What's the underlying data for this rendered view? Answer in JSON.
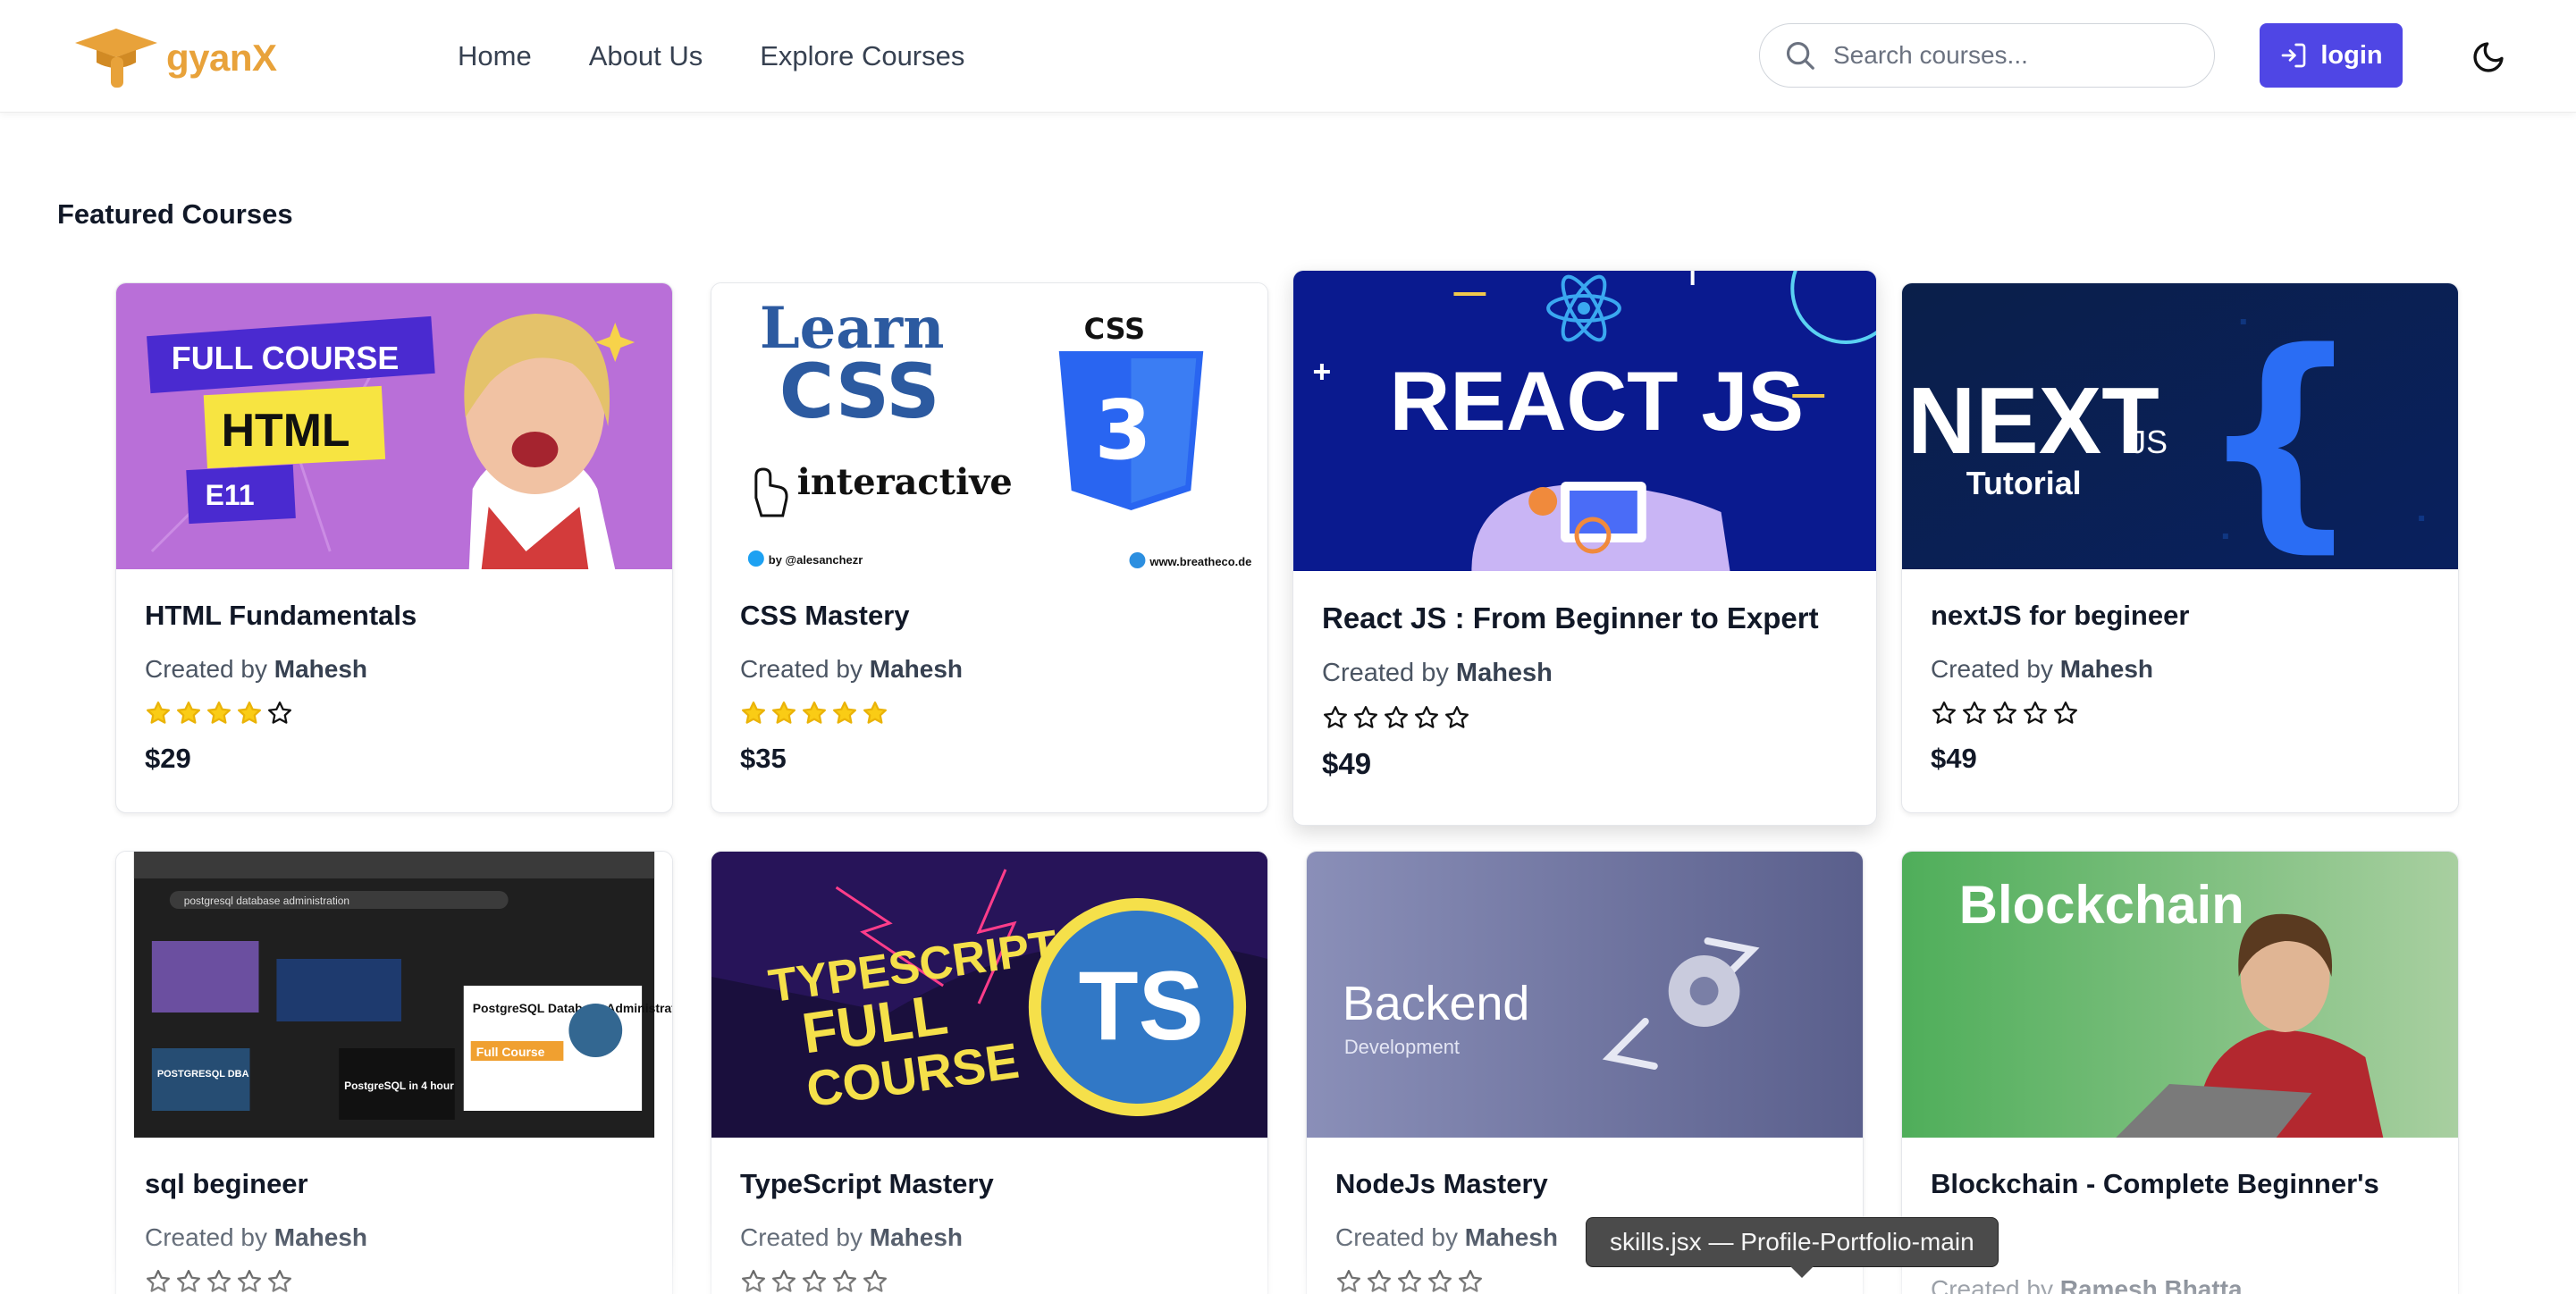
{
  "brand": {
    "name": "gyanX",
    "logo_icon": "graduation-cap-icon"
  },
  "nav": {
    "links": [
      "Home",
      "About Us",
      "Explore Courses"
    ]
  },
  "search": {
    "placeholder": "Search courses...",
    "icon": "search-icon"
  },
  "login": {
    "label": "login",
    "icon": "login-arrow-icon"
  },
  "theme_toggle": {
    "icon": "moon-icon"
  },
  "colors": {
    "accent": "#4f46e5",
    "brand": "#e8a23a",
    "star": "#facc15"
  },
  "section": {
    "title": "Featured Courses"
  },
  "created_by_prefix": "Created by",
  "courses": [
    {
      "title": "HTML Fundamentals",
      "author": "Mahesh",
      "rating": 4,
      "price": "$29",
      "thumb": {
        "top_badge": "FULL COURSE",
        "main": "HTML",
        "sub": "E11"
      }
    },
    {
      "title": "CSS Mastery",
      "author": "Mahesh",
      "rating": 5,
      "price": "$35",
      "thumb": {
        "line1": "Learn",
        "line2": "CSS",
        "line3": "interactive",
        "shield_label": "CSS",
        "shield_number": "3",
        "credit_left": "by @alesanchezr",
        "credit_right": "www.breatheco.de"
      }
    },
    {
      "title": "React JS : From Beginner to Expert",
      "author": "Mahesh",
      "rating": 0,
      "price": "$49",
      "thumb": {
        "main": "REACT JS"
      }
    },
    {
      "title": "nextJS for begineer",
      "author": "Mahesh",
      "rating": 0,
      "price": "$49",
      "thumb": {
        "main": "NEXT",
        "suffix": ".JS",
        "sub": "Tutorial"
      }
    },
    {
      "title": "sql begineer",
      "author": "Mahesh",
      "rating": 0,
      "price": "",
      "thumb": {
        "search_text": "postgresql database administration",
        "overlay1": "PostgreSQL Database Administration",
        "overlay2": "Full Course",
        "overlay3": "PostgreSQL in 4 hour",
        "overlay4": "POSTGRESQL DBA"
      }
    },
    {
      "title": "TypeScript Mastery",
      "author": "Mahesh",
      "rating": 0,
      "price": "",
      "thumb": {
        "line1": "TYPESCRIPT",
        "line2": "FULL",
        "line3": "COURSE",
        "badge": "TS"
      }
    },
    {
      "title": "NodeJs Mastery",
      "author": "Mahesh",
      "rating": 0,
      "price": "",
      "thumb": {
        "main": "Backend",
        "sub": "Development"
      }
    },
    {
      "title": "Blockchain - Complete Beginner's",
      "author": "Ramesh Bhatta",
      "rating": 0,
      "price": "",
      "thumb": {
        "main": "Blockchain"
      }
    }
  ],
  "tooltip": {
    "text": "skills.jsx — Profile-Portfolio-main"
  }
}
